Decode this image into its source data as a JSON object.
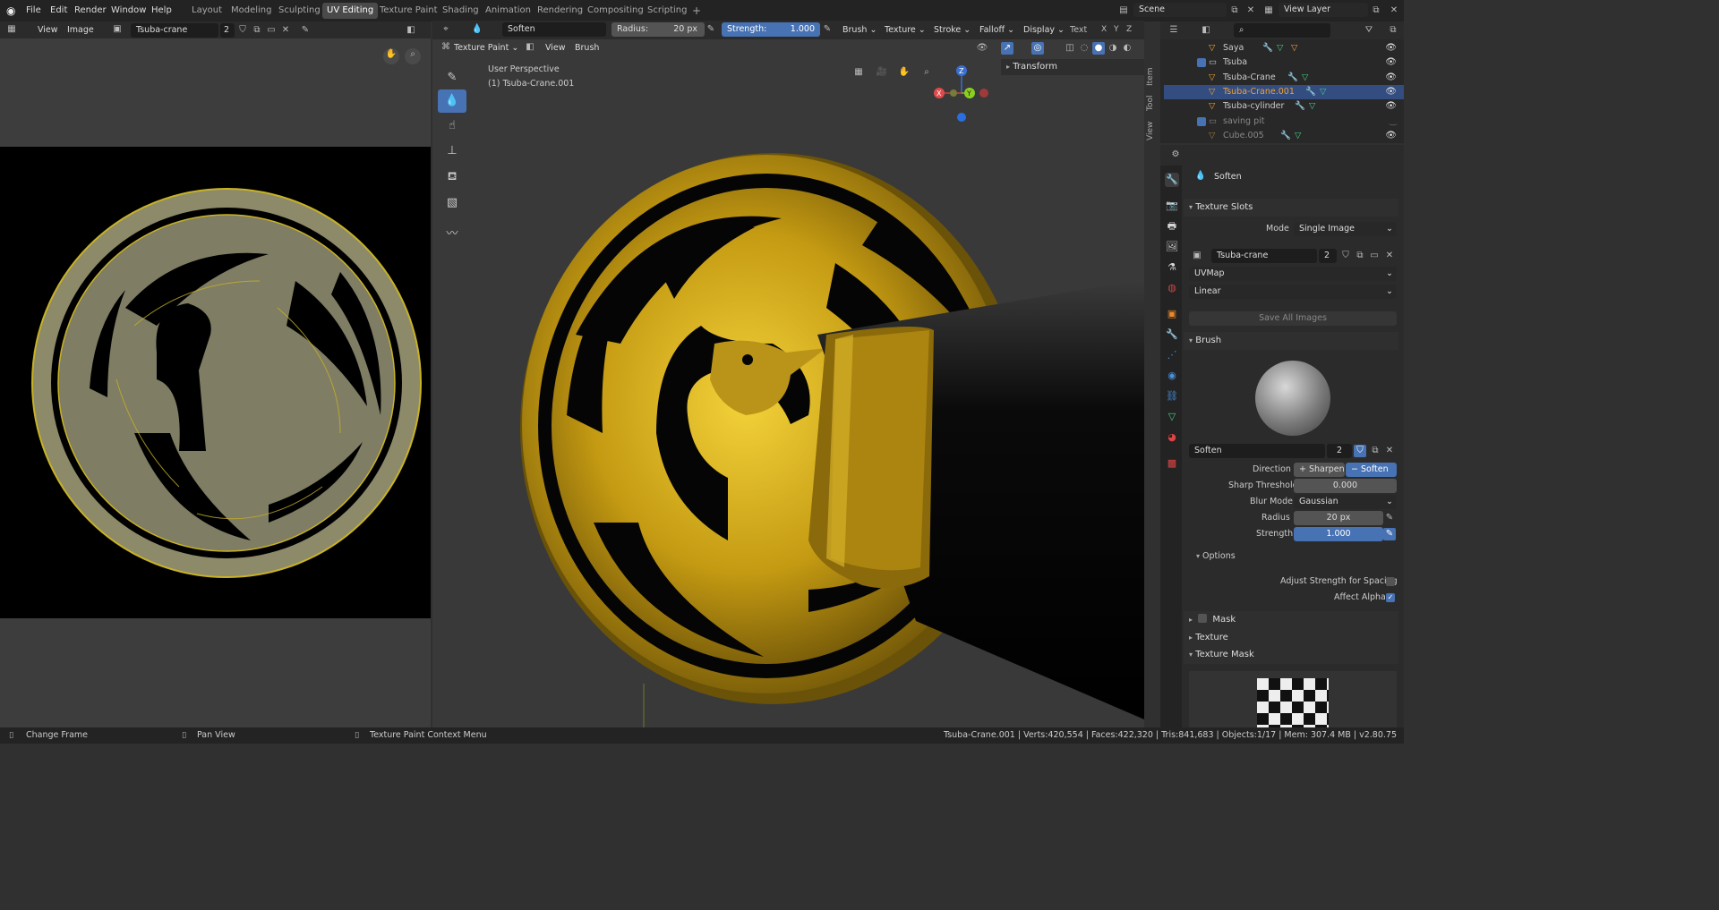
{
  "menubar": {
    "items": [
      "File",
      "Edit",
      "Render",
      "Window",
      "Help"
    ],
    "workspaces": [
      "Layout",
      "Modeling",
      "Sculpting",
      "UV Editing",
      "Texture Paint",
      "Shading",
      "Animation",
      "Rendering",
      "Compositing",
      "Scripting"
    ],
    "active_workspace": "UV Editing",
    "add_tab": "+",
    "scene": "Scene",
    "view_layer": "View Layer"
  },
  "image_editor": {
    "menu": [
      "View",
      "Image"
    ],
    "image_name": "Tsuba-crane",
    "users": "2"
  },
  "viewport_header": {
    "mode": "Texture Paint",
    "menu": [
      "View",
      "Brush"
    ],
    "brush": "Soften",
    "radius_label": "Radius:",
    "radius_value": "20 px",
    "strength_label": "Strength:",
    "strength_value": "1.000",
    "dropdowns": [
      "Brush",
      "Texture",
      "Stroke",
      "Falloff",
      "Display"
    ],
    "text_label": "Text"
  },
  "viewport": {
    "perspective": "User Perspective",
    "object": "(1) Tsuba-Crane.001",
    "transform": "Transform",
    "tabs": [
      "Item",
      "Tool",
      "View"
    ],
    "axes": {
      "x": "X",
      "y": "Y",
      "z": "Z"
    },
    "xyz": [
      "X",
      "Y",
      "Z"
    ]
  },
  "outliner": {
    "rows": [
      {
        "name": "Saya",
        "color": "#ccc"
      },
      {
        "name": "Tsuba",
        "color": "#ccc"
      },
      {
        "name": "Tsuba-Crane",
        "color": "#ccc"
      },
      {
        "name": "Tsuba-Crane.001",
        "color": "#f0a030"
      },
      {
        "name": "Tsuba-cylinder",
        "color": "#ccc"
      },
      {
        "name": "saving pit",
        "color": "#888"
      },
      {
        "name": "Cube.005",
        "color": "#888"
      }
    ]
  },
  "properties": {
    "brush_name": "Soften",
    "texture_slots": {
      "title": "Texture Slots",
      "mode_label": "Mode",
      "mode_value": "Single Image",
      "image": "Tsuba-crane",
      "users": "2",
      "uvmap": "UVMap",
      "interp": "Linear",
      "save_all": "Save All Images"
    },
    "brush": {
      "title": "Brush",
      "name": "Soften",
      "users": "2",
      "direction_label": "Direction",
      "dir_sharpen": "Sharpen",
      "dir_soften": "Soften",
      "sharp_threshold_label": "Sharp Threshold",
      "sharp_threshold": "0.000",
      "blur_mode_label": "Blur Mode",
      "blur_mode": "Gaussian",
      "radius_label": "Radius",
      "radius": "20 px",
      "strength_label": "Strength",
      "strength": "1.000"
    },
    "options": {
      "title": "Options",
      "adjust_strength": "Adjust Strength for Spacing",
      "affect_alpha": "Affect Alpha"
    },
    "mask": "Mask",
    "texture": "Texture",
    "texture_mask": "Texture Mask"
  },
  "statusbar": {
    "left1": "Change Frame",
    "left2": "Pan View",
    "left3": "Texture Paint Context Menu",
    "stats": "Tsuba-Crane.001 | Verts:420,554 | Faces:422,320 | Tris:841,683 | Objects:1/17 | Mem: 307.4 MB | v2.80.75"
  },
  "colors": {
    "accent": "#4772b3",
    "gold": "#c8a21a",
    "active_object": "#f0a030"
  }
}
